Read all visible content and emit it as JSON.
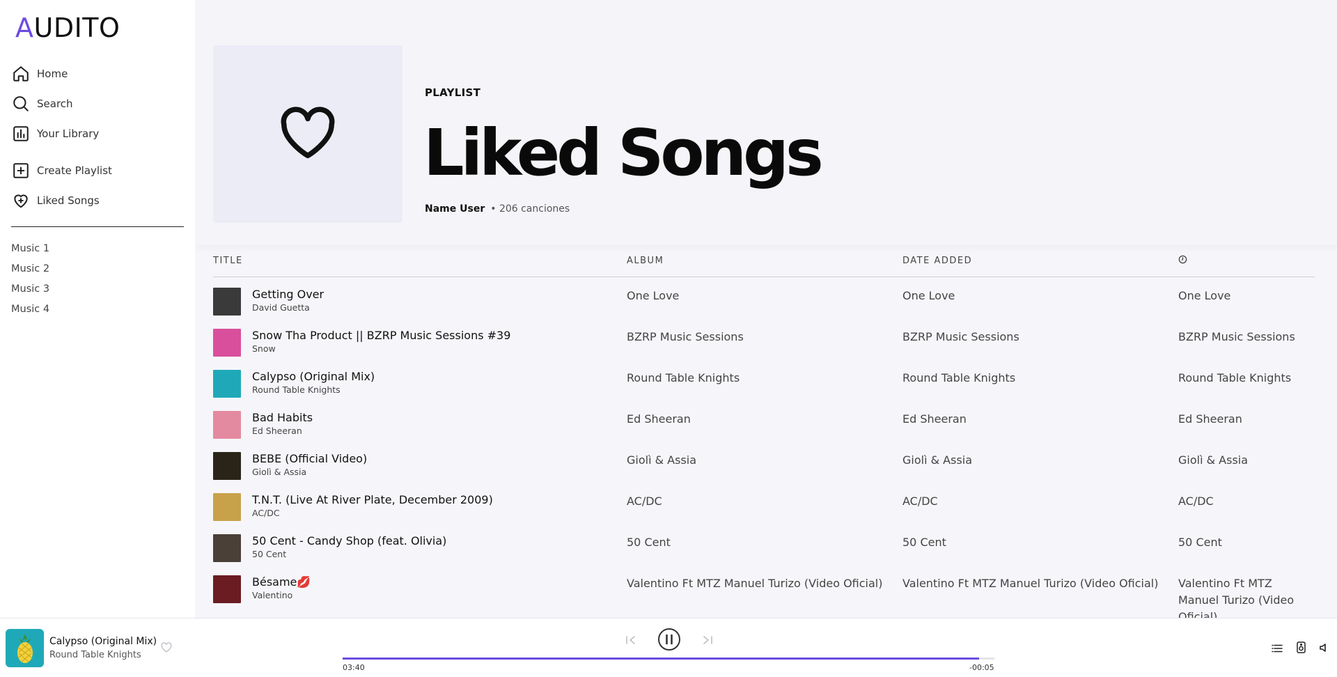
{
  "app": {
    "logo_first": "A",
    "logo_rest": "UDITO",
    "accent": "#6c4ce0"
  },
  "sidebar": {
    "nav": [
      {
        "label": "Home",
        "icon": "home-icon"
      },
      {
        "label": "Search",
        "icon": "search-icon"
      },
      {
        "label": "Your Library",
        "icon": "library-icon"
      }
    ],
    "actions": [
      {
        "label": "Create Playlist",
        "icon": "plus-square-icon"
      },
      {
        "label": "Liked Songs",
        "icon": "heart-plus-icon"
      }
    ],
    "playlists": [
      "Music 1",
      "Music 2",
      "Music 3",
      "Music 4"
    ]
  },
  "header": {
    "type": "PLAYLIST",
    "title": "Liked Songs",
    "user": "Name User",
    "count": "• 206 canciones",
    "cover_icon": "heart-icon"
  },
  "table": {
    "columns": {
      "title": "TITLE",
      "album": "ALBUM",
      "date": "DATE ADDED",
      "duration_icon": "clock-icon"
    },
    "rows": [
      {
        "title": "Getting Over",
        "artist": "David Guetta",
        "album": "One Love",
        "date": "One Love",
        "duration": "One Love",
        "thumb_color": "#3a3a3a"
      },
      {
        "title": "Snow Tha Product || BZRP Music Sessions #39",
        "artist": "Snow",
        "album": "BZRP Music Sessions",
        "date": "BZRP Music Sessions",
        "duration": "BZRP Music Sessions",
        "thumb_color": "#d94f9c"
      },
      {
        "title": "Calypso (Original Mix)",
        "artist": "Round Table Knights",
        "album": "Round Table Knights",
        "date": "Round Table Knights",
        "duration": "Round Table Knights",
        "thumb_color": "#1fa9b8"
      },
      {
        "title": "Bad Habits",
        "artist": "Ed Sheeran",
        "album": "Ed Sheeran",
        "date": "Ed Sheeran",
        "duration": "Ed Sheeran",
        "thumb_color": "#e48aa0"
      },
      {
        "title": "BEBE (Official Video)",
        "artist": "Giolì & Assia",
        "album": "Giolì & Assia",
        "date": "Giolì & Assia",
        "duration": "Giolì & Assia",
        "thumb_color": "#2a2418"
      },
      {
        "title": "T.N.T. (Live At River Plate, December 2009)",
        "artist": "AC/DC",
        "album": "AC/DC",
        "date": "AC/DC",
        "duration": "AC/DC",
        "thumb_color": "#c8a24a"
      },
      {
        "title": "50 Cent - Candy Shop (feat. Olivia)",
        "artist": "50 Cent",
        "album": "50 Cent",
        "date": "50 Cent",
        "duration": "50 Cent",
        "thumb_color": "#4a4038"
      },
      {
        "title": "Bésame💋",
        "artist": "Valentino",
        "album": "Valentino Ft MTZ Manuel Turizo (Video Oficial)",
        "date": "Valentino Ft MTZ Manuel Turizo (Video Oficial)",
        "duration": "Valentino Ft MTZ Manuel Turizo (Video Oficial)",
        "thumb_color": "#6b1c22"
      }
    ]
  },
  "player": {
    "title": "Calypso (Original Mix)",
    "artist": "Round Table Knights",
    "elapsed": "03:40",
    "remaining": "-00:05",
    "progress": 0.976,
    "thumb_color": "#1fa9b8"
  }
}
